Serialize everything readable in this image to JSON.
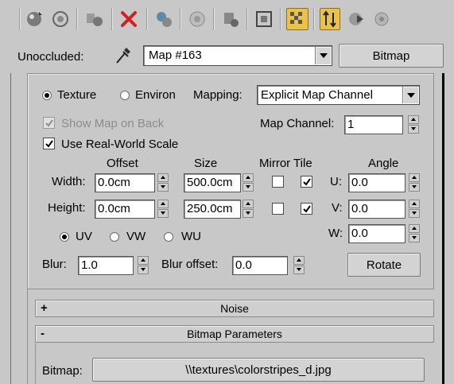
{
  "toolbar": {
    "icons": [
      "material-ball-icon",
      "get-material-icon",
      "assign-material-icon",
      "delete-icon",
      "make-unique-icon",
      "put-to-library-icon",
      "material-id-icon",
      "show-map-icon",
      "show-background-icon",
      "go-to-parent-icon",
      "go-forward-icon",
      "options-icon"
    ],
    "active": [
      "show-background-icon",
      "go-to-parent-icon"
    ]
  },
  "top_row": {
    "label": "Unoccluded:",
    "map_name": "Map #163",
    "map_type_button": "Bitmap"
  },
  "coordinates": {
    "texture_label": "Texture",
    "environ_label": "Environ",
    "mapping_label": "Mapping:",
    "mapping_value": "Explicit Map Channel",
    "show_map_on_back": "Show Map on Back",
    "map_channel_label": "Map Channel:",
    "map_channel_value": "1",
    "use_real_world_scale": "Use Real-World Scale",
    "headers": {
      "offset": "Offset",
      "size": "Size",
      "mirror_tile": "Mirror Tile",
      "angle": "Angle"
    },
    "width_label": "Width:",
    "height_label": "Height:",
    "width_offset": "0.0cm",
    "height_offset": "0.0cm",
    "width_size": "500.0cm",
    "height_size": "250.0cm",
    "u_label": "U:",
    "v_label": "V:",
    "w_label": "W:",
    "u_angle": "0.0",
    "v_angle": "0.0",
    "w_angle": "0.0",
    "uv_label": "UV",
    "vw_label": "VW",
    "wu_label": "WU",
    "blur_label": "Blur:",
    "blur_value": "1.0",
    "blur_offset_label": "Blur offset:",
    "blur_offset_value": "0.0",
    "rotate_button": "Rotate"
  },
  "rollouts": {
    "noise": {
      "sign": "+",
      "title": "Noise"
    },
    "bitmap_params": {
      "sign": "-",
      "title": "Bitmap Parameters"
    }
  },
  "bitmap": {
    "label": "Bitmap:",
    "path": "\\\\textures\\colorstripes_d.jpg"
  },
  "colors": {
    "background": "#c8c8c8",
    "active_toggle": "#e9c24d",
    "field": "#ffffff"
  }
}
